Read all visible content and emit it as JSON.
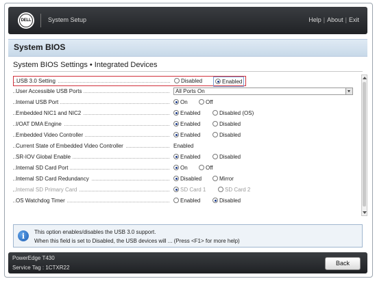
{
  "topbar": {
    "logo_text": "DELL",
    "app_title": "System Setup",
    "links": [
      "Help",
      "About",
      "Exit"
    ],
    "separator": "|"
  },
  "header": {
    "page_title": "System BIOS"
  },
  "section": {
    "title": "System BIOS Settings • Integrated Devices"
  },
  "settings": {
    "usb30": {
      "label": "USB 3.0 Setting",
      "options": [
        "Disabled",
        "Enabled"
      ],
      "selected": "Enabled"
    },
    "usb_ports": {
      "label": "User Accessible USB Ports",
      "value": "All Ports On"
    },
    "internal_usb": {
      "label": "Internal USB Port",
      "options": [
        "On",
        "Off"
      ],
      "selected": "On"
    },
    "nic": {
      "label": "Embedded NIC1 and NIC2",
      "options": [
        "Enabled",
        "Disabled (OS)"
      ],
      "selected": "Enabled"
    },
    "ioat": {
      "label": "I/OAT DMA Engine",
      "options": [
        "Enabled",
        "Disabled"
      ],
      "selected": "Enabled"
    },
    "video": {
      "label": "Embedded Video Controller",
      "options": [
        "Enabled",
        "Disabled"
      ],
      "selected": "Enabled"
    },
    "video_state": {
      "label": "Current State of Embedded Video Controller",
      "value": "Enabled"
    },
    "sriov": {
      "label": "SR-IOV Global Enable",
      "options": [
        "Enabled",
        "Disabled"
      ],
      "selected": "Enabled"
    },
    "sd_port": {
      "label": "Internal SD Card Port",
      "options": [
        "On",
        "Off"
      ],
      "selected": "On"
    },
    "sd_redundancy": {
      "label": "Internal SD Card Redundancy",
      "options": [
        "Disabled",
        "Mirror"
      ],
      "selected": "Disabled"
    },
    "sd_primary": {
      "label": "Internal SD Primary Card",
      "options": [
        "SD Card 1",
        "SD Card 2"
      ],
      "selected": "SD Card 1"
    },
    "watchdog": {
      "label": "OS Watchdog Timer",
      "options": [
        "Enabled",
        "Disabled"
      ],
      "selected": "Disabled"
    }
  },
  "help": {
    "icon": "info-icon",
    "line1": "This option enables/disables the USB 3.0 support.",
    "line2": "When this field is set to Disabled, the USB devices will ... (Press <F1> for more help)"
  },
  "footer": {
    "model": "PowerEdge T430",
    "service_tag": "Service Tag : 1CTXR22",
    "back_label": "Back"
  }
}
